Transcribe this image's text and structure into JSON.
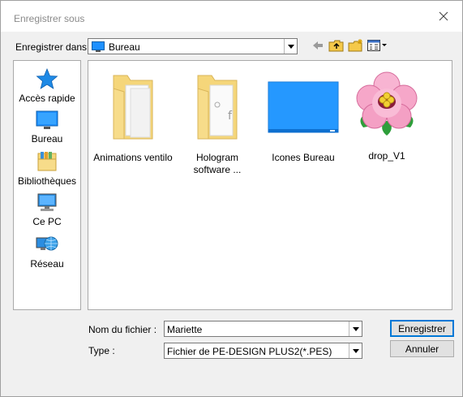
{
  "window": {
    "title": "Enregistrer sous",
    "close_icon": "close-icon"
  },
  "toolbar": {
    "save_in_label": "Enregistrer dans :",
    "location": "Bureau",
    "back_icon": "back-arrow-icon",
    "up_icon": "folder-up-icon",
    "new_folder_icon": "new-folder-icon",
    "view_menu_icon": "view-menu-icon"
  },
  "places": [
    {
      "label": "Accès rapide",
      "icon": "star-icon"
    },
    {
      "label": "Bureau",
      "icon": "desktop-icon"
    },
    {
      "label": "Bibliothèques",
      "icon": "libraries-icon"
    },
    {
      "label": "Ce PC",
      "icon": "computer-icon"
    },
    {
      "label": "Réseau",
      "icon": "network-icon"
    }
  ],
  "files": [
    {
      "name": "Animations ventilo",
      "icon": "folder-icon"
    },
    {
      "name_line1": "Hologram",
      "name_line2": "software ...",
      "icon": "folder-icon"
    },
    {
      "name": "Icones Bureau",
      "icon": "desktop-screen-icon"
    },
    {
      "name": "drop_V1",
      "icon": "flower-icon"
    }
  ],
  "form": {
    "filename_label": "Nom du fichier :",
    "filename_value": "Mariette",
    "type_label": "Type :",
    "type_value": "Fichier de PE-DESIGN PLUS2(*.PES)"
  },
  "buttons": {
    "save": "Enregistrer",
    "cancel": "Annuler"
  },
  "colors": {
    "accent": "#0078d7",
    "folder": "#f5d67a",
    "title_text": "#8a8a8a"
  }
}
